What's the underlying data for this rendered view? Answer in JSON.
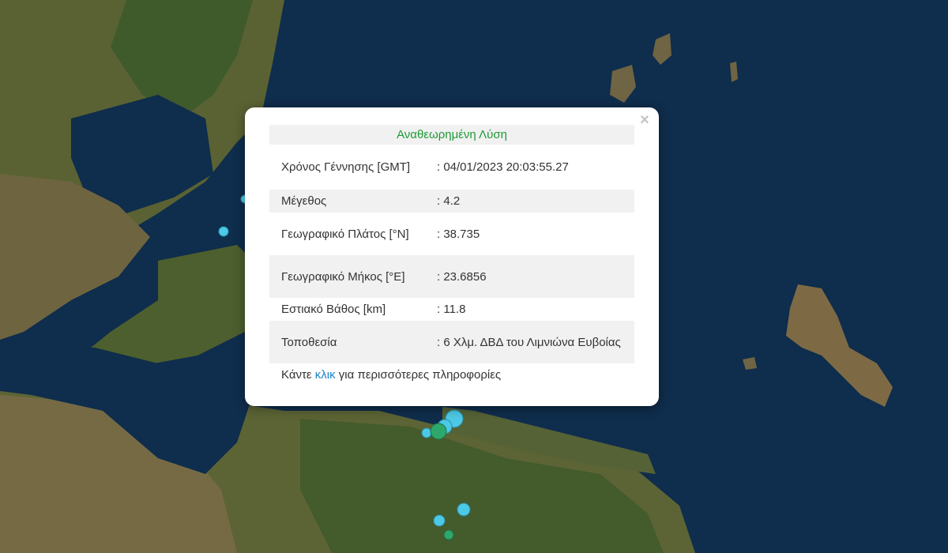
{
  "popup": {
    "title": "Αναθεωρημένη Λύση",
    "close_label": "×",
    "rows": [
      {
        "label": "Χρόνος Γέννησης [GMT]",
        "value": ": 04/01/2023 20:03:55.27"
      },
      {
        "label": "Μέγεθος",
        "value": ": 4.2"
      },
      {
        "label": "Γεωγραφικό Πλάτος [°N]",
        "value": ": 38.735"
      },
      {
        "label": "Γεωγραφικό Μήκος [°E]",
        "value": ": 23.6856"
      },
      {
        "label": "Εστιακό Βάθος [km]",
        "value": ": 11.8"
      },
      {
        "label": "Τοποθεσία",
        "value": ": 6 Χλμ. ΔΒΔ του Λιμνιώνα Ευβοίας"
      }
    ],
    "more_prefix": "Κάντε ",
    "more_link": "κλικ",
    "more_suffix": " για περισσότερες πληροφορίες"
  },
  "colors": {
    "sea": "#0f2d4c",
    "land": "#4f5e2f",
    "marker_light": "#4cc9e6",
    "marker_green": "#2ea86a",
    "title_green": "#1d9a36",
    "link_blue": "#1a86c8"
  }
}
